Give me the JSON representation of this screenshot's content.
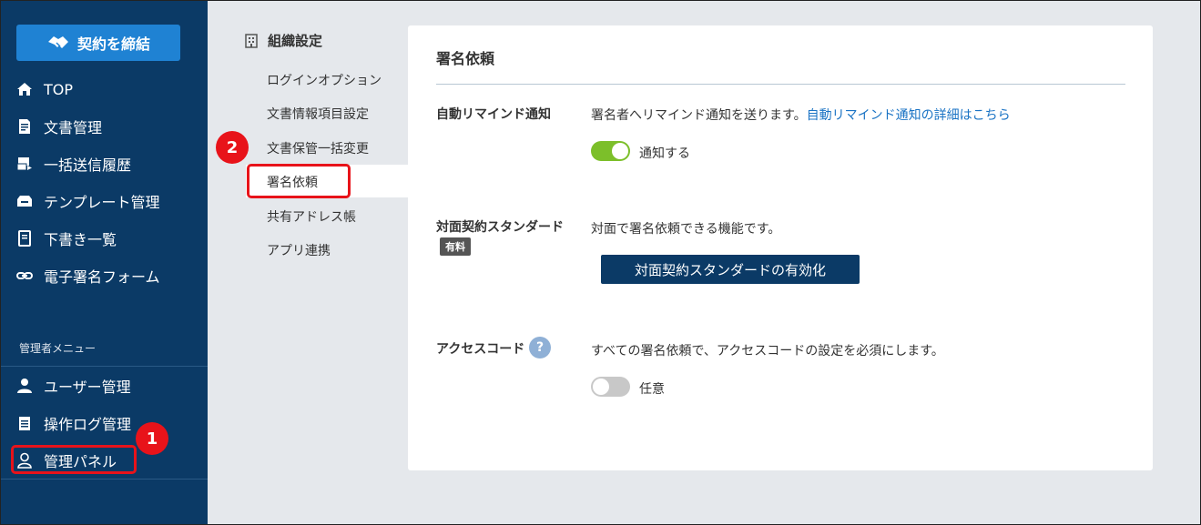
{
  "sidebar": {
    "contract_button": "契約を締結",
    "items": [
      {
        "label": "TOP",
        "icon": "home-icon"
      },
      {
        "label": "文書管理",
        "icon": "document-icon"
      },
      {
        "label": "一括送信履歴",
        "icon": "bulk-send-icon"
      },
      {
        "label": "テンプレート管理",
        "icon": "template-icon"
      },
      {
        "label": "下書き一覧",
        "icon": "draft-icon"
      },
      {
        "label": "電子署名フォーム",
        "icon": "link-icon"
      }
    ],
    "admin_heading": "管理者メニュー",
    "admin_items": [
      {
        "label": "ユーザー管理",
        "icon": "user-icon"
      },
      {
        "label": "操作ログ管理",
        "icon": "log-icon"
      },
      {
        "label": "管理パネル",
        "icon": "admin-panel-icon"
      }
    ]
  },
  "submenu": {
    "title": "組織設定",
    "items": [
      "ログインオプション",
      "文書情報項目設定",
      "文書保管一括変更",
      "署名依頼",
      "共有アドレス帳",
      "アプリ連携"
    ],
    "active": "署名依頼"
  },
  "panel": {
    "title": "署名依頼",
    "reminder": {
      "label": "自動リマインド通知",
      "desc": "署名者へリマインド通知を送ります。",
      "link": "自動リマインド通知の詳細はこちら",
      "toggle_label": "通知する",
      "toggle_on": true
    },
    "face_to_face": {
      "label": "対面契約スタンダード",
      "badge": "有料",
      "desc": "対面で署名依頼できる機能です。",
      "button": "対面契約スタンダードの有効化"
    },
    "access_code": {
      "label": "アクセスコード",
      "help": "?",
      "desc": "すべての署名依頼で、アクセスコードの設定を必須にします。",
      "toggle_label": "任意",
      "toggle_on": false
    }
  },
  "annotations": {
    "step1": "1",
    "step2": "2"
  },
  "colors": {
    "sidebar": "#0b3a66",
    "accent": "#1f82d3",
    "toggle_on": "#7cbf2a",
    "callout": "#e8131a"
  }
}
